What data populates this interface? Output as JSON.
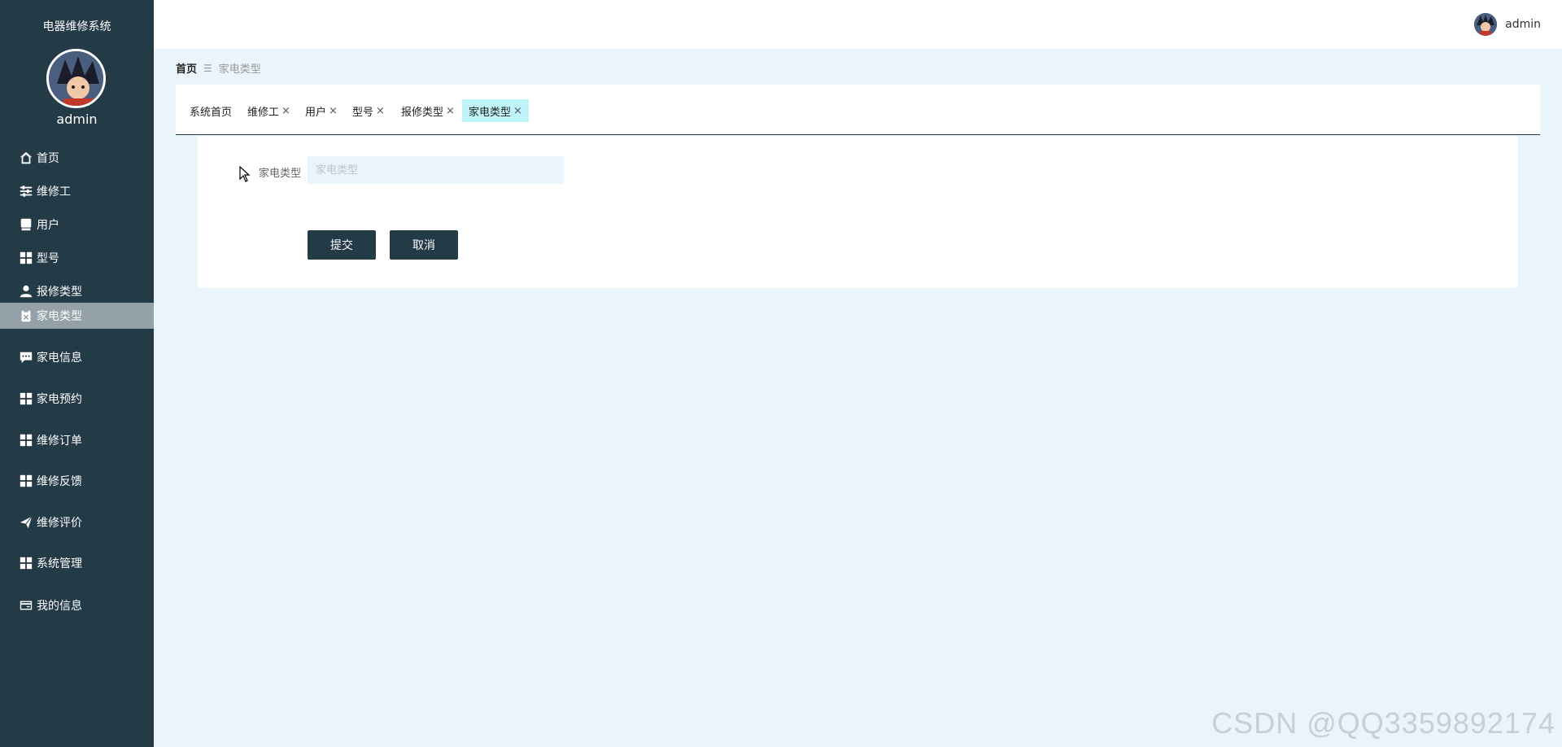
{
  "app": {
    "title": "电器维修系统"
  },
  "sidebar": {
    "user": "admin",
    "items": [
      {
        "label": "首页",
        "icon": "home-icon"
      },
      {
        "label": "维修工",
        "icon": "sliders-icon"
      },
      {
        "label": "用户",
        "icon": "user-card-icon"
      },
      {
        "label": "型号",
        "icon": "grid-icon"
      },
      {
        "label": "报修类型",
        "icon": "person-icon"
      },
      {
        "label": "家电类型",
        "icon": "clipboard-icon",
        "active": true
      },
      {
        "label": "家电信息",
        "icon": "chat-icon"
      },
      {
        "label": "家电预约",
        "icon": "grid-icon"
      },
      {
        "label": "维修订单",
        "icon": "grid-icon"
      },
      {
        "label": "维修反馈",
        "icon": "grid-icon"
      },
      {
        "label": "维修评价",
        "icon": "paper-plane-icon"
      },
      {
        "label": "系统管理",
        "icon": "grid-icon"
      },
      {
        "label": "我的信息",
        "icon": "credit-card-icon"
      }
    ]
  },
  "header": {
    "user": "admin"
  },
  "breadcrumb": {
    "home": "首页",
    "separator": "☰",
    "current": "家电类型"
  },
  "tabs": [
    {
      "label": "系统首页",
      "closable": false
    },
    {
      "label": "维修工",
      "closable": true
    },
    {
      "label": "用户",
      "closable": true
    },
    {
      "label": "型号",
      "closable": true
    },
    {
      "label": "报修类型",
      "closable": true
    },
    {
      "label": "家电类型",
      "closable": true,
      "active": true
    }
  ],
  "tab_close_glyph": "×",
  "form": {
    "field_label": "家电类型",
    "field_placeholder": "家电类型",
    "field_value": "",
    "submit_label": "提交",
    "cancel_label": "取消"
  },
  "watermark": "CSDN @QQ3359892174",
  "colors": {
    "sidebar_bg": "#233a47",
    "active_menu_bg": "#94a1a8",
    "page_bg": "#eaf5fb",
    "active_tab_bg": "#bff4f8",
    "button_bg": "#233a47"
  }
}
